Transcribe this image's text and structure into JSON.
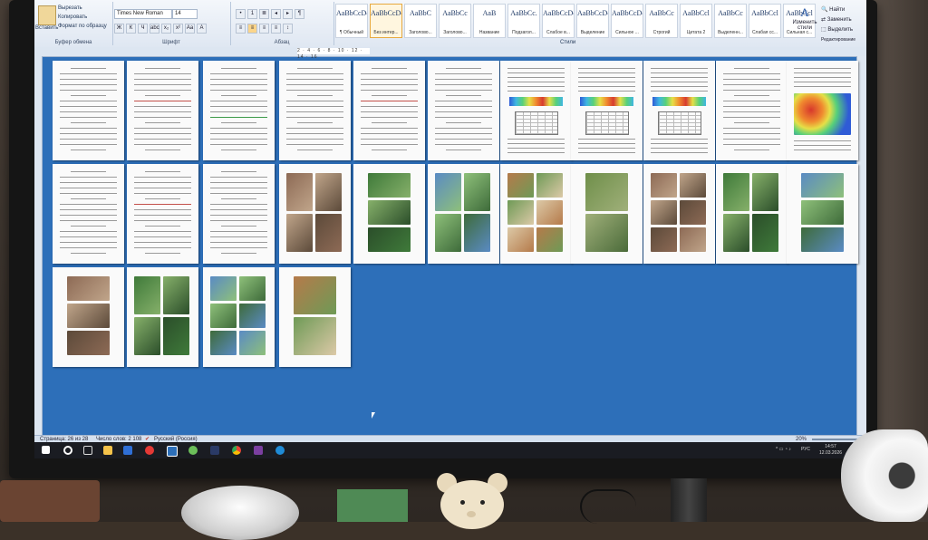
{
  "ribbon": {
    "clipboard": {
      "paste": "Вставить",
      "cut": "Вырезать",
      "copy": "Копировать",
      "format_painter": "Формат по образцу",
      "group_label": "Буфер обмена"
    },
    "font": {
      "name": "Times New Roman",
      "size": "14",
      "group_label": "Шрифт",
      "buttons": [
        "Ж",
        "К",
        "Ч",
        "abc",
        "x₂",
        "x²",
        "Aa",
        "A"
      ]
    },
    "paragraph": {
      "group_label": "Абзац",
      "buttons": [
        "≡",
        "≡",
        "≡",
        "≡",
        "↕",
        "¶"
      ]
    },
    "styles": {
      "group_label": "Стили",
      "items": [
        {
          "sample": "AaBbCcDc",
          "name": "¶ Обычный"
        },
        {
          "sample": "AaBbCcDc",
          "name": "Без интер..."
        },
        {
          "sample": "AaBbC",
          "name": "Заголово..."
        },
        {
          "sample": "AaBbCc",
          "name": "Заголово..."
        },
        {
          "sample": "AaB",
          "name": "Название"
        },
        {
          "sample": "AaBbCc.",
          "name": "Подзагол..."
        },
        {
          "sample": "AaBbCcDc",
          "name": "Слабое в..."
        },
        {
          "sample": "AaBbCcDc",
          "name": "Выделение"
        },
        {
          "sample": "AaBbCcDc",
          "name": "Сильное ..."
        },
        {
          "sample": "AaBbCc",
          "name": "Строгий"
        },
        {
          "sample": "AaBbCcl",
          "name": "Цитата 2"
        },
        {
          "sample": "AaBbCc",
          "name": "Выделенн..."
        },
        {
          "sample": "AaBbCcl",
          "name": "Слабая сс..."
        },
        {
          "sample": "AaBbCcl",
          "name": "Сильная с..."
        }
      ],
      "change_styles": "Изменить стили"
    },
    "editing": {
      "find": "Найти",
      "replace": "Заменить",
      "select": "Выделить",
      "group_label": "Редактирование"
    }
  },
  "ruler": {
    "marks": "2 · 4 · 6 · 8 · 10 · 12 · 14 · 16"
  },
  "status": {
    "page": "Страница: 26 из 28",
    "words": "Число слов: 2 108",
    "language": "Русский (Россия)",
    "zoom": "20%"
  },
  "taskbar": {
    "lang": "РУС",
    "time": "14:57",
    "date": "12.03.2026"
  },
  "colors": {
    "workspace": "#2d6fb9",
    "accent_style": "#e7a93f"
  }
}
